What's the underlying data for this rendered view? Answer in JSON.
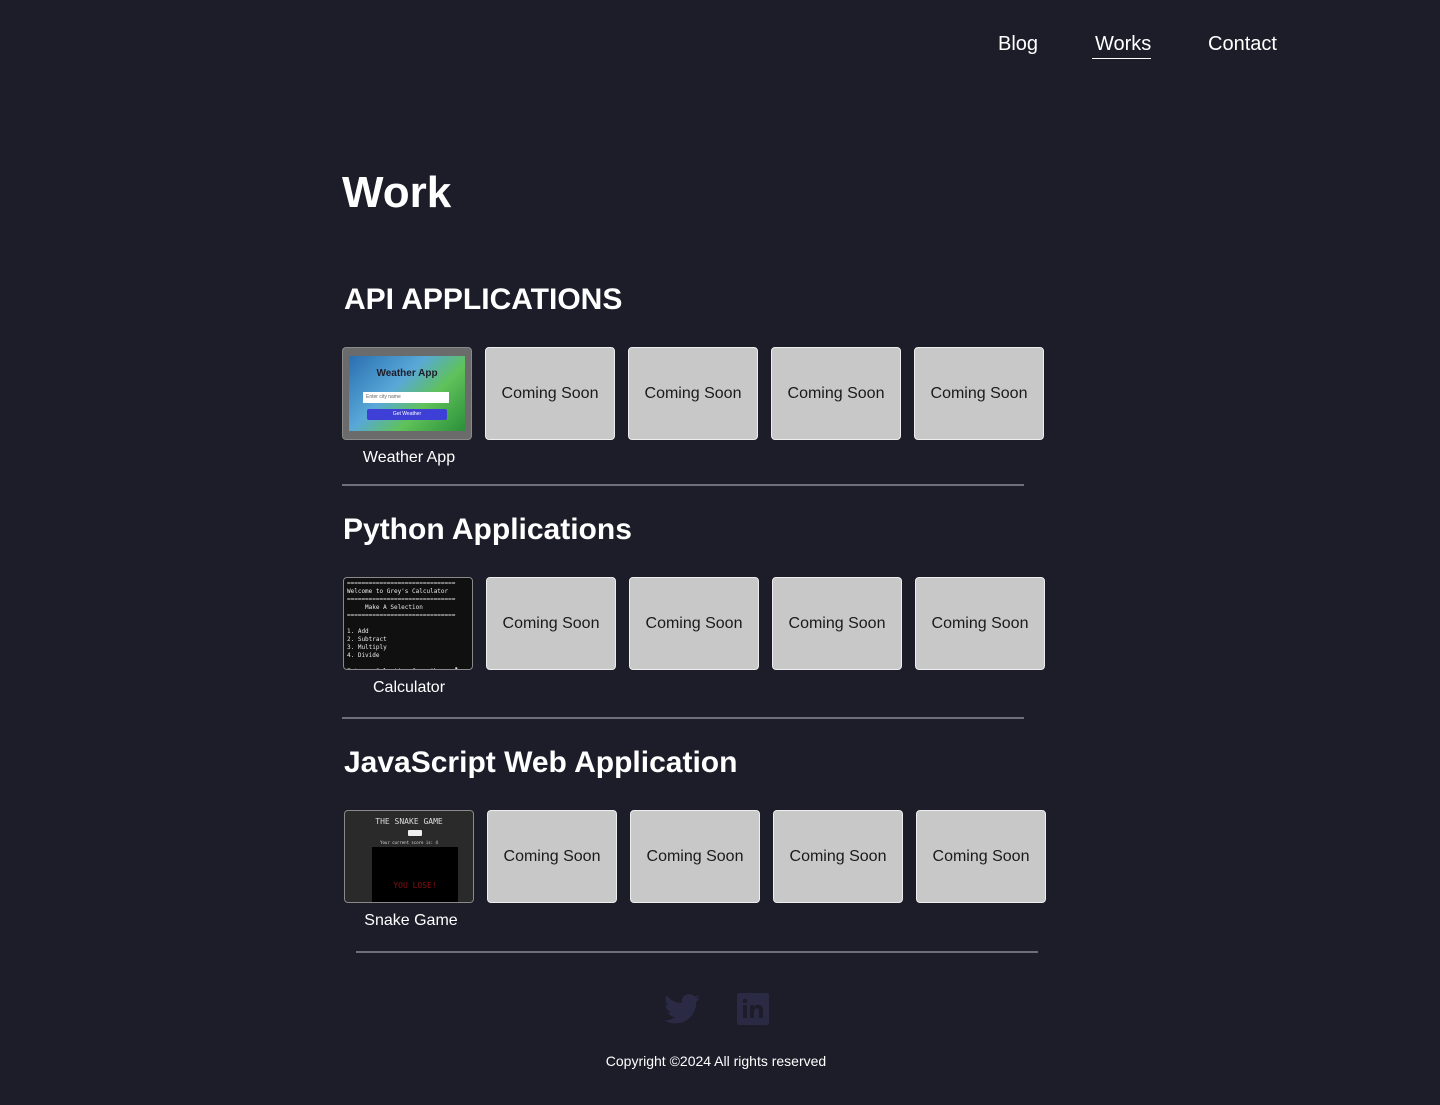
{
  "nav": {
    "items": [
      {
        "label": "Blog"
      },
      {
        "label": "Works",
        "active": true
      },
      {
        "label": "Contact"
      }
    ]
  },
  "page": {
    "title": "Work"
  },
  "sections": [
    {
      "title": "API APPLICATIONS",
      "featured": {
        "caption": "Weather App",
        "thumb": {
          "title": "Weather App",
          "input_placeholder": "Enter city name",
          "button": "Get Weather"
        }
      },
      "placeholders": [
        "Coming Soon",
        "Coming Soon",
        "Coming Soon",
        "Coming Soon"
      ]
    },
    {
      "title": "Python Applications",
      "featured": {
        "caption": "Calculator",
        "thumb": {
          "lines": [
            "==============================",
            "Welcome to Grey's Calculator",
            "==============================",
            "     Make A Selection",
            "==============================",
            "",
            "1. Add",
            "2. Subtract",
            "3. Multiply",
            "4. Divide",
            "",
            "Enter a Selection from Above: ▌"
          ]
        }
      },
      "placeholders": [
        "Coming Soon",
        "Coming Soon",
        "Coming Soon",
        "Coming Soon"
      ]
    },
    {
      "title": "JavaScript Web Application",
      "featured": {
        "caption": "Snake Game",
        "thumb": {
          "title": "THE SNAKE GAME",
          "score_text": "Your current score is: 4",
          "lose_text": "YOU LOSE!"
        }
      },
      "placeholders": [
        "Coming Soon",
        "Coming Soon",
        "Coming Soon",
        "Coming Soon"
      ]
    }
  ],
  "footer": {
    "icons": [
      "twitter-icon",
      "linkedin-icon"
    ],
    "copyright": "Copyright ©2024 All rights reserved"
  },
  "colors": {
    "background": "#1d1c29",
    "card": "#c8c8c8",
    "divider": "#6f6f7a",
    "social_icon": "#2b2a45"
  }
}
